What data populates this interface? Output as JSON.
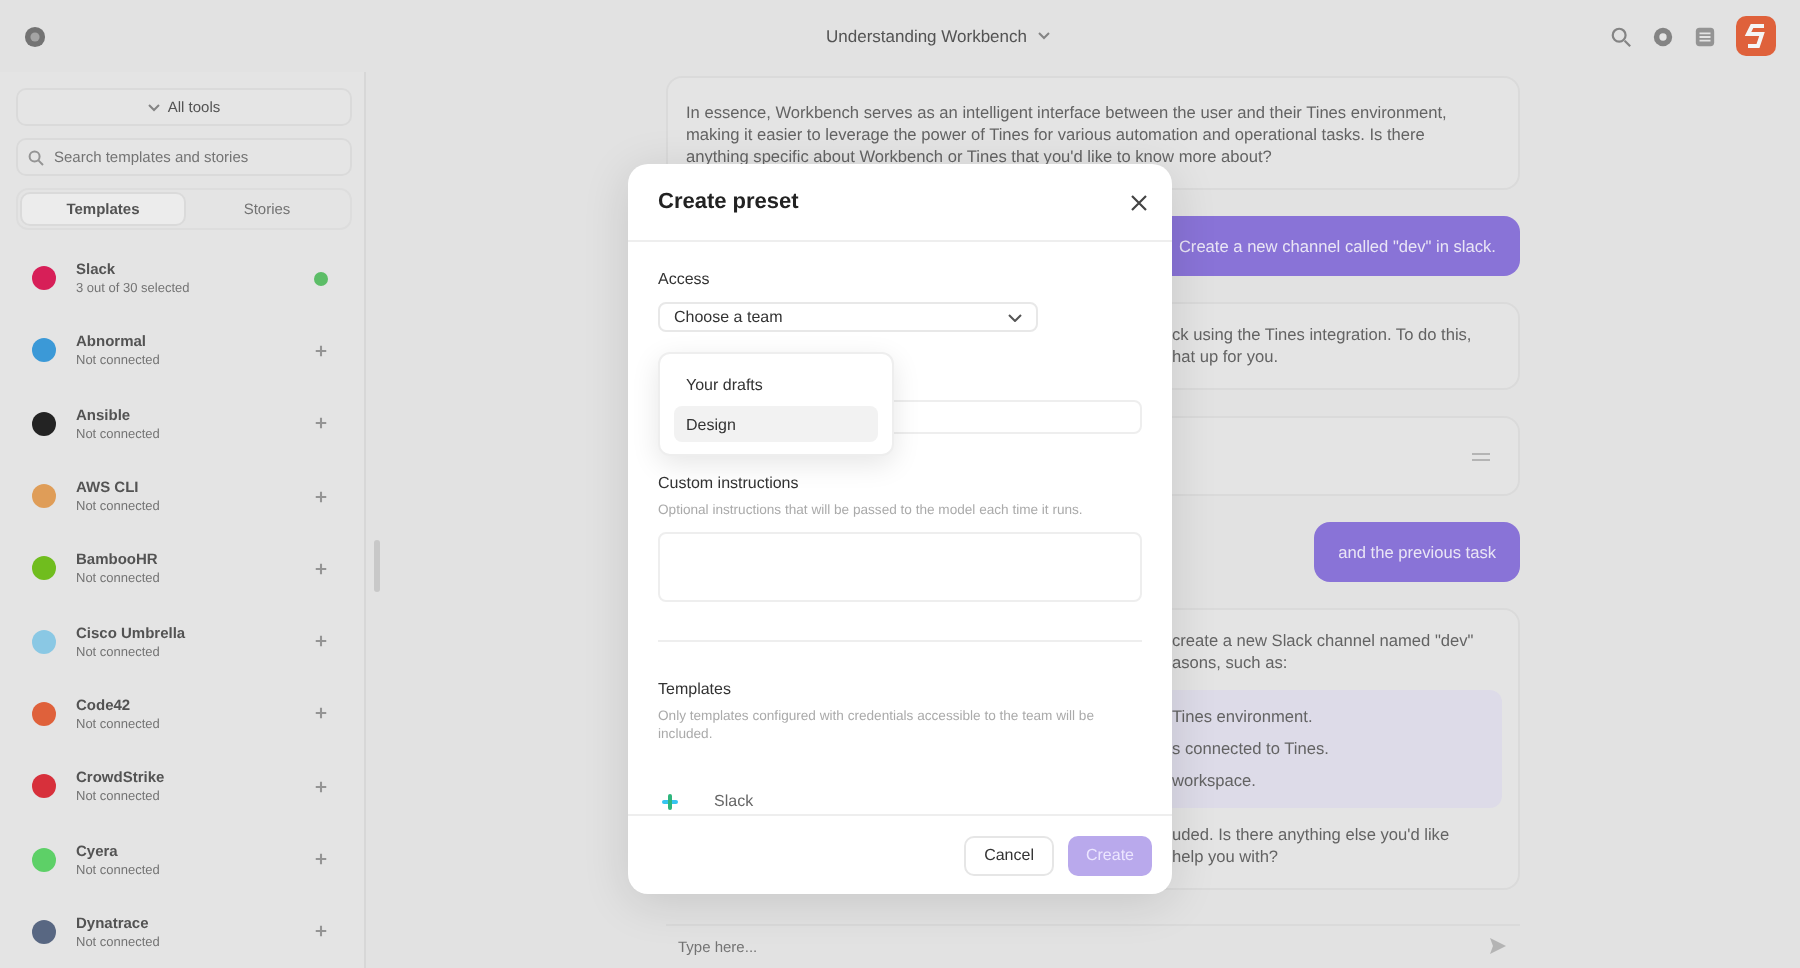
{
  "topbar": {
    "title": "Understanding Workbench"
  },
  "sidebar": {
    "filter_button": "All tools",
    "search": {
      "placeholder": "Search templates and stories"
    },
    "tabs": [
      {
        "label": "Templates",
        "selected": true
      },
      {
        "label": "Stories",
        "selected": false
      }
    ],
    "items": [
      {
        "name": "Slack",
        "status": "3 out of 30 selected",
        "connected": true,
        "color": "#e01e5a"
      },
      {
        "name": "Abnormal",
        "status": "Not connected",
        "connected": false,
        "color": "#3b9fe0"
      },
      {
        "name": "Ansible",
        "status": "Not connected",
        "connected": false,
        "color": "#222222"
      },
      {
        "name": "AWS CLI",
        "status": "Not connected",
        "connected": false,
        "color": "#e8a35a"
      },
      {
        "name": "BambooHR",
        "status": "Not connected",
        "connected": false,
        "color": "#73c41d"
      },
      {
        "name": "Cisco Umbrella",
        "status": "Not connected",
        "connected": false,
        "color": "#8fd0ee"
      },
      {
        "name": "Code42",
        "status": "Not connected",
        "connected": false,
        "color": "#e8643c"
      },
      {
        "name": "CrowdStrike",
        "status": "Not connected",
        "connected": false,
        "color": "#e0303c"
      },
      {
        "name": "Cyera",
        "status": "Not connected",
        "connected": false,
        "color": "#5fd86a"
      },
      {
        "name": "Dynatrace",
        "status": "Not connected",
        "connected": false,
        "color": "#5a6a86"
      }
    ]
  },
  "chat": {
    "messages": [
      {
        "kind": "assistant",
        "lines": [
          "In essence, Workbench serves as an intelligent interface between the user and their Tines environment,",
          "making it easier to leverage the power of Tines for various automation and operational tasks. Is there",
          "anything specific about Workbench or Tines that you'd like to know more about?"
        ]
      },
      {
        "kind": "user",
        "text": "Create a new channel called \"dev\" in slack."
      },
      {
        "kind": "assistant_cut",
        "lines": [
          "ck using the Tines integration. To do this,",
          "hat up for you."
        ]
      },
      {
        "kind": "tool"
      },
      {
        "kind": "user",
        "text": "and the previous task"
      },
      {
        "kind": "assistant_cut",
        "lines": [
          "create a new Slack channel named \"dev\"",
          "asons, such as:"
        ],
        "list": [
          "Tines environment.",
          "s connected to Tines.",
          "workspace."
        ],
        "after": [
          "uded. Is there anything else you'd like",
          "help you with?"
        ]
      }
    ],
    "input": {
      "placeholder": "Type here..."
    }
  },
  "modal": {
    "title": "Create preset",
    "access": {
      "label": "Access",
      "select": "Choose a team",
      "options": [
        {
          "label": "Your drafts",
          "selected": false
        },
        {
          "label": "Design",
          "selected": true
        }
      ]
    },
    "instructions": {
      "label": "Custom instructions",
      "hint": "Optional instructions that will be passed to the model each time it runs."
    },
    "templates": {
      "label": "Templates",
      "hint": "Only templates configured with credentials accessible to the team will be included.",
      "items": [
        "Slack"
      ]
    },
    "buttons": [
      {
        "label": "Cancel",
        "kind": "secondary",
        "disabled": false
      },
      {
        "label": "Create",
        "kind": "primary",
        "disabled": true
      }
    ]
  }
}
